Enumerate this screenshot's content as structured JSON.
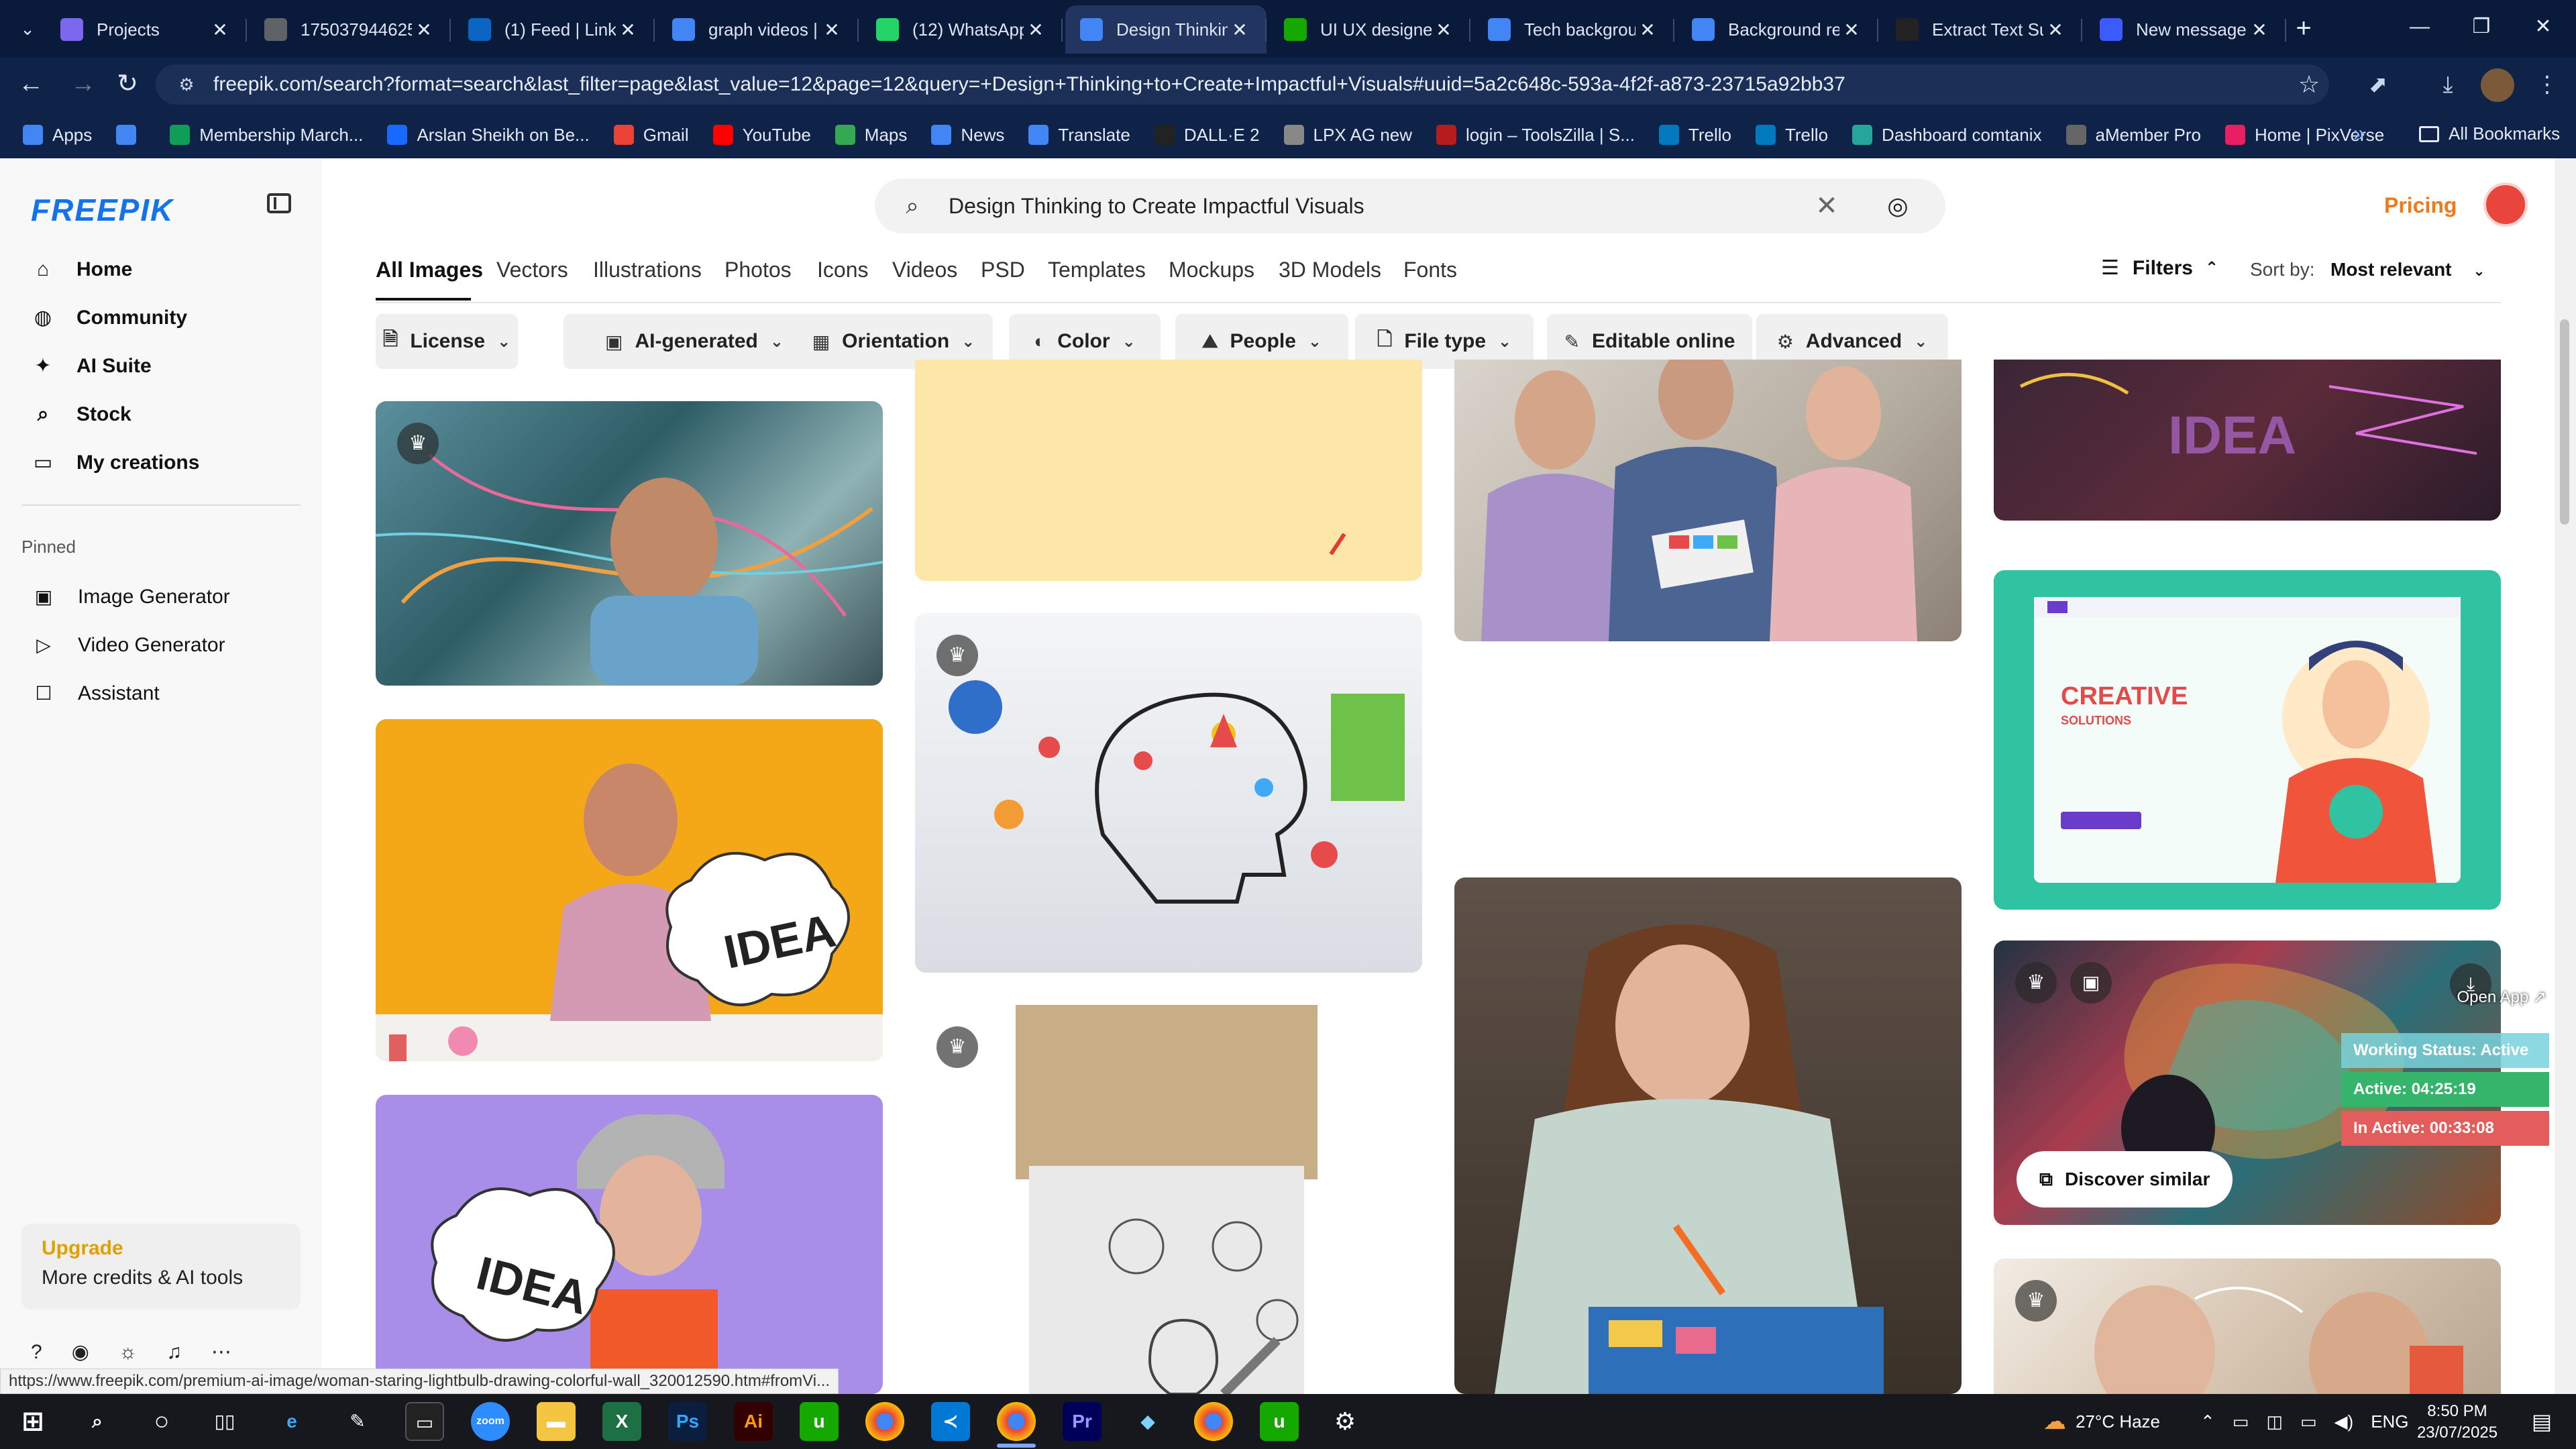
{
  "browser": {
    "tabs": [
      {
        "title": "Projects",
        "icon": "clickup",
        "color": "#7b68ee"
      },
      {
        "title": "175037944625",
        "icon": "globe",
        "color": "#5f6368"
      },
      {
        "title": "(1) Feed | Linke",
        "icon": "linkedin",
        "color": "#0a66c2"
      },
      {
        "title": "graph videos |",
        "icon": "docs",
        "color": "#4285f4"
      },
      {
        "title": "(12) WhatsApp",
        "icon": "whatsapp",
        "color": "#25d366"
      },
      {
        "title": "Design Thinkin",
        "icon": "docs",
        "color": "#4285f4"
      },
      {
        "title": "UI UX designer",
        "icon": "upwork",
        "color": "#14a800"
      },
      {
        "title": "Tech backgrou",
        "icon": "docs",
        "color": "#4285f4"
      },
      {
        "title": "Background re",
        "icon": "docs",
        "color": "#4285f4"
      },
      {
        "title": "Extract Text Su",
        "icon": "globe",
        "color": "#222222"
      },
      {
        "title": "New message",
        "icon": "pen",
        "color": "#3b5bff"
      }
    ],
    "url": "freepik.com/search?format=search&last_filter=page&last_value=12&page=12&query=+Design+Thinking+to+Create+Impactful+Visuals#uuid=5a2c648c-593a-4f2f-a873-23715a92bb37",
    "bookmarks": [
      {
        "label": "Apps",
        "icon": "apps-grid",
        "color": "#4285f4"
      },
      {
        "label": "",
        "icon": "grid",
        "color": "#4285f4"
      },
      {
        "label": "Membership March...",
        "icon": "bookmark",
        "color": "#0f9d58"
      },
      {
        "label": "Arslan Sheikh on Be...",
        "icon": "behance",
        "color": "#1769ff"
      },
      {
        "label": "Gmail",
        "icon": "gmail",
        "color": "#ea4335"
      },
      {
        "label": "YouTube",
        "icon": "youtube",
        "color": "#ff0000"
      },
      {
        "label": "Maps",
        "icon": "maps",
        "color": "#34a853"
      },
      {
        "label": "News",
        "icon": "news",
        "color": "#4285f4"
      },
      {
        "label": "Translate",
        "icon": "translate",
        "color": "#4285f4"
      },
      {
        "label": "DALL·E 2",
        "icon": "openai",
        "color": "#222222"
      },
      {
        "label": "LPX AG new",
        "icon": "dots",
        "color": "#888888"
      },
      {
        "label": "login – ToolsZilla | S...",
        "icon": "toolszilla",
        "color": "#b71c1c"
      },
      {
        "label": "Trello",
        "icon": "trello",
        "color": "#0079bf"
      },
      {
        "label": "Trello",
        "icon": "trello",
        "color": "#0079bf"
      },
      {
        "label": "Dashboard comtanix",
        "icon": "dashboard",
        "color": "#26a69a"
      },
      {
        "label": "aMember Pro",
        "icon": "amember",
        "color": "#666666"
      },
      {
        "label": "Home | PixVerse",
        "icon": "pixverse",
        "color": "#e91e63"
      }
    ],
    "all_bookmarks": "All Bookmarks"
  },
  "sidebar": {
    "logo": "FREEPIK",
    "nav": [
      {
        "label": "Home",
        "icon": "home-icon",
        "glyph": "⌂"
      },
      {
        "label": "Community",
        "icon": "globe-icon",
        "glyph": "◍"
      },
      {
        "label": "AI Suite",
        "icon": "sparkle-icon",
        "glyph": "✦"
      },
      {
        "label": "Stock",
        "icon": "search-icon",
        "glyph": "⌕"
      },
      {
        "label": "My creations",
        "icon": "folder-icon",
        "glyph": "▭"
      }
    ],
    "pinned_label": "Pinned",
    "pinned": [
      {
        "label": "Image Generator",
        "icon": "image-icon",
        "glyph": "▣"
      },
      {
        "label": "Video Generator",
        "icon": "video-icon",
        "glyph": "▷"
      },
      {
        "label": "Assistant",
        "icon": "chat-icon",
        "glyph": "☐"
      }
    ],
    "upgrade_title": "Upgrade",
    "upgrade_sub": "More credits & AI tools"
  },
  "header": {
    "search_value": "Design Thinking to Create Impactful Visuals",
    "pricing": "Pricing",
    "tabs": [
      "All Images",
      "Vectors",
      "Illustrations",
      "Photos",
      "Icons",
      "Videos",
      "PSD",
      "Templates",
      "Mockups",
      "3D Models",
      "Fonts"
    ],
    "filters": "Filters",
    "sort_label": "Sort by:",
    "sort_value": "Most relevant"
  },
  "chips": [
    {
      "label": "License",
      "glyph": "🗎"
    },
    {
      "label": "AI-generated",
      "glyph": "▣"
    },
    {
      "label": "Orientation",
      "glyph": "▦"
    },
    {
      "label": "Color",
      "glyph": "◐"
    },
    {
      "label": "People",
      "glyph": "⛰"
    },
    {
      "label": "File type",
      "glyph": "🗋"
    },
    {
      "label": "Editable online",
      "glyph": "✎"
    },
    {
      "label": "Advanced",
      "glyph": "⚙"
    }
  ],
  "cards": {
    "discover_similar": "Discover similar"
  },
  "tracker": {
    "open_app": "Open App ↗",
    "working_status": "Working Status: Active",
    "active_time": "Active: 04:25:19",
    "inactive_time": "In Active: 00:33:08"
  },
  "status_url": "https://www.freepik.com/premium-ai-image/woman-staring-lightbulb-drawing-colorful-wall_320012590.htm#fromVi...",
  "taskbar": {
    "weather": "27°C Haze",
    "lang": "ENG",
    "time": "8:50 PM",
    "date": "23/07/2025"
  },
  "colors": {
    "brand": "#1273eb",
    "pricing": "#f07a1a",
    "upgrade": "#e0a000",
    "tracker_active": "#35b56b",
    "tracker_inactive": "#e35d5d"
  }
}
